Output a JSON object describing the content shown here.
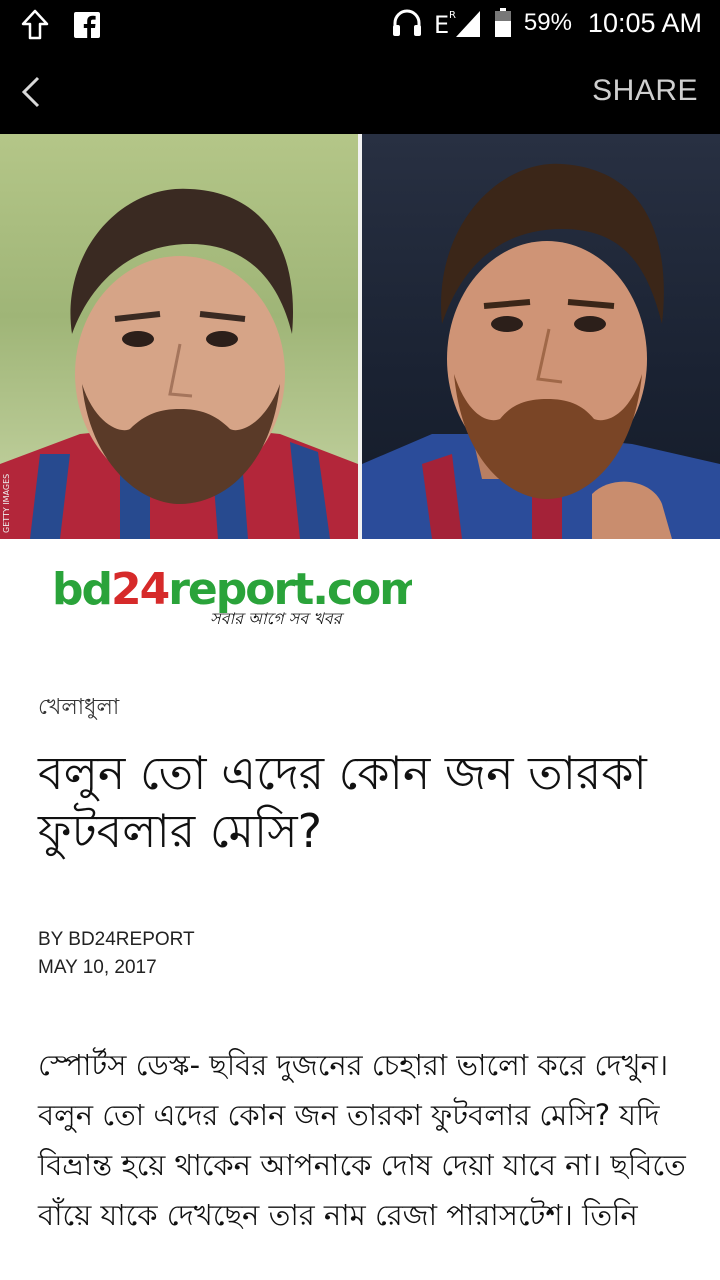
{
  "status_bar": {
    "battery": "59%",
    "time": "10:05 AM",
    "network": "E"
  },
  "app_bar": {
    "share_label": "SHARE"
  },
  "hero": {
    "credit": "GETTY IMAGES"
  },
  "logo": {
    "brand_main": "bd24report.com",
    "brand_tagline": "সবার আগে সব খবর",
    "color_green": "#2aa33a",
    "color_red": "#d62a2a"
  },
  "article": {
    "category": "খেলাধুলা",
    "headline": "বলুন তো এদের কোন জন তারকা ফুটবলার মেসি?",
    "byline": "BY BD24REPORT",
    "date": "MAY 10, 2017",
    "body": "স্পোর্টস ডেস্ক- ছবির দুজনের চেহারা ভালো করে দেখুন। বলুন তো এদের কোন জন তারকা ফুটবলার মেসি? যদি বিভ্রান্ত হয়ে থাকেন আপনাকে দোষ দেয়া যাবে না। ছবিতে বাঁয়ে যাকে দেখছেন তার নাম রেজা পারাসটেশ। তিনি"
  }
}
